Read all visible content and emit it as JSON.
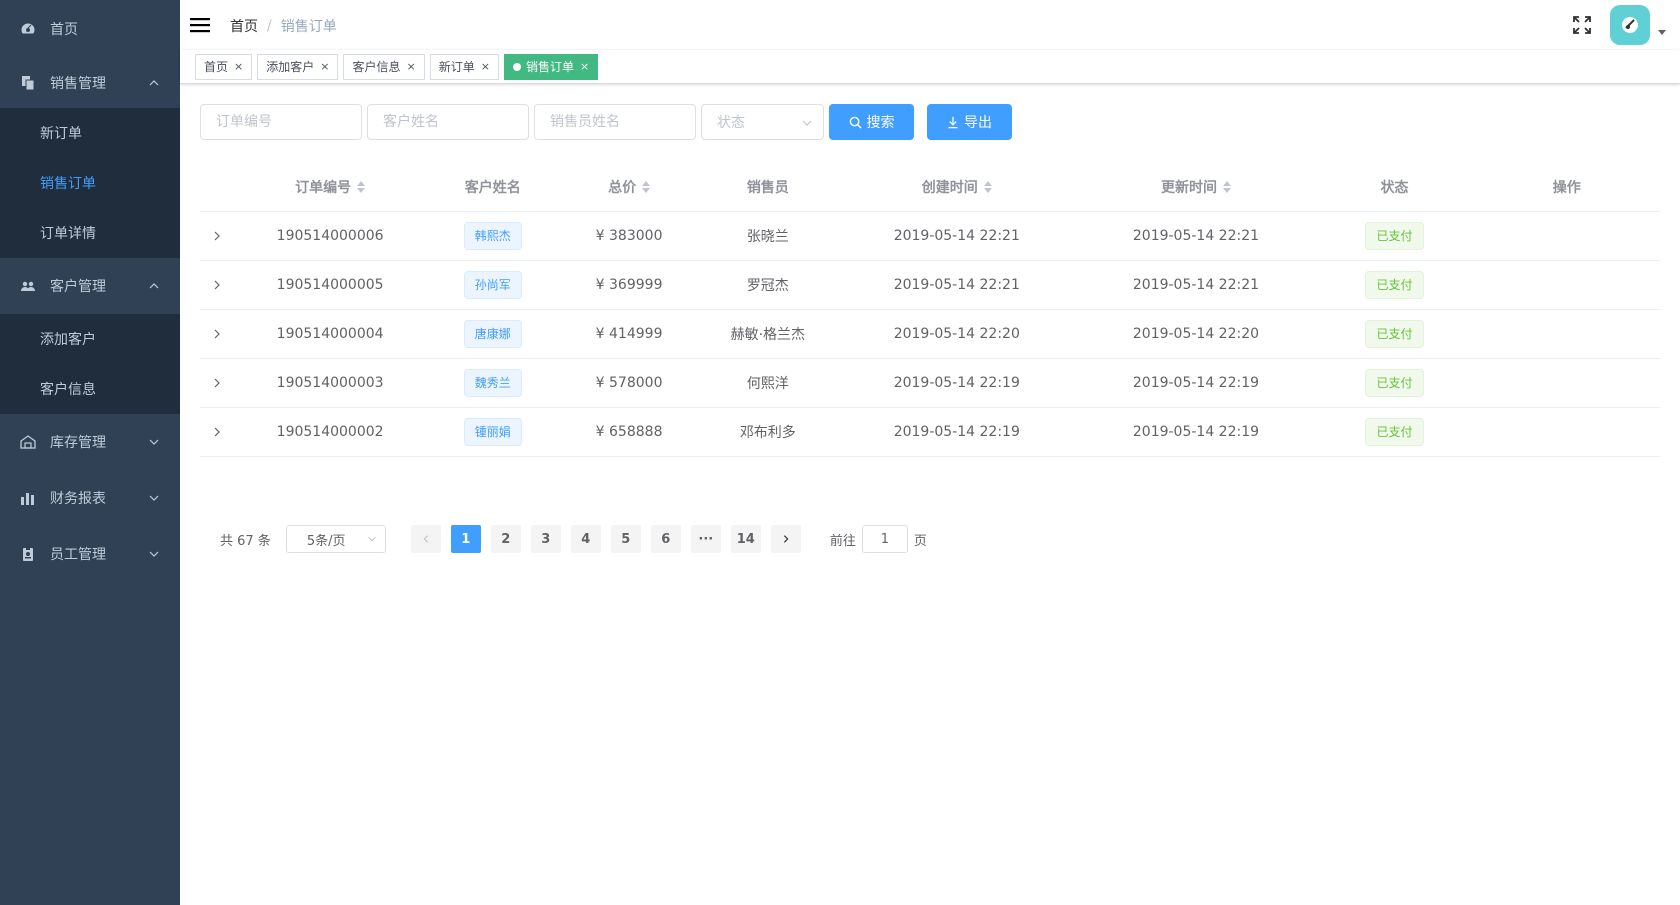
{
  "sidebar": {
    "items": [
      {
        "label": "首页",
        "icon": "dashboard-icon"
      },
      {
        "label": "销售管理",
        "icon": "documents-icon",
        "expanded": true,
        "children": [
          {
            "label": "新订单"
          },
          {
            "label": "销售订单",
            "active": true
          },
          {
            "label": "订单详情"
          }
        ]
      },
      {
        "label": "客户管理",
        "icon": "users-icon",
        "expanded": true,
        "children": [
          {
            "label": "添加客户"
          },
          {
            "label": "客户信息"
          }
        ]
      },
      {
        "label": "库存管理",
        "icon": "warehouse-icon",
        "expanded": false
      },
      {
        "label": "财务报表",
        "icon": "bar-chart-icon",
        "expanded": false
      },
      {
        "label": "员工管理",
        "icon": "badge-icon",
        "expanded": false
      }
    ]
  },
  "header": {
    "breadcrumb": {
      "home": "首页",
      "separator": "/",
      "current": "销售订单"
    }
  },
  "tags": [
    {
      "label": "首页",
      "active": false
    },
    {
      "label": "添加客户",
      "active": false
    },
    {
      "label": "客户信息",
      "active": false
    },
    {
      "label": "新订单",
      "active": false
    },
    {
      "label": "销售订单",
      "active": true
    }
  ],
  "tag_close": "×",
  "filter": {
    "order_no_placeholder": "订单编号",
    "customer_placeholder": "客户姓名",
    "salesperson_placeholder": "销售员姓名",
    "status_placeholder": "状态",
    "search_label": "搜索",
    "export_label": "导出"
  },
  "table": {
    "columns": [
      "订单编号",
      "客户姓名",
      "总价",
      "销售员",
      "创建时间",
      "更新时间",
      "状态",
      "操作"
    ],
    "rows": [
      {
        "order_no": "190514000006",
        "customer": "韩熙杰",
        "price": "¥ 383000",
        "salesperson": "张晓兰",
        "created": "2019-05-14 22:21",
        "updated": "2019-05-14 22:21",
        "status": "已支付"
      },
      {
        "order_no": "190514000005",
        "customer": "孙尚军",
        "price": "¥ 369999",
        "salesperson": "罗冠杰",
        "created": "2019-05-14 22:21",
        "updated": "2019-05-14 22:21",
        "status": "已支付"
      },
      {
        "order_no": "190514000004",
        "customer": "唐康娜",
        "price": "¥ 414999",
        "salesperson": "赫敏·格兰杰",
        "created": "2019-05-14 22:20",
        "updated": "2019-05-14 22:20",
        "status": "已支付"
      },
      {
        "order_no": "190514000003",
        "customer": "魏秀兰",
        "price": "¥ 578000",
        "salesperson": "何熙洋",
        "created": "2019-05-14 22:19",
        "updated": "2019-05-14 22:19",
        "status": "已支付"
      },
      {
        "order_no": "190514000002",
        "customer": "锺丽娟",
        "price": "¥ 658888",
        "salesperson": "邓布利多",
        "created": "2019-05-14 22:19",
        "updated": "2019-05-14 22:19",
        "status": "已支付"
      }
    ]
  },
  "pagination": {
    "total_text": "共 67 条",
    "page_size": "5条/页",
    "pages": [
      "1",
      "2",
      "3",
      "4",
      "5",
      "6",
      "···",
      "14"
    ],
    "current_page": "1",
    "jump_prefix": "前往",
    "jump_value": "1",
    "jump_suffix": "页"
  },
  "colors": {
    "sidebar_bg": "#304156",
    "submenu_bg": "#1f2d3d",
    "primary": "#409eff",
    "active_tag": "#42b983",
    "success": "#67c23a"
  }
}
